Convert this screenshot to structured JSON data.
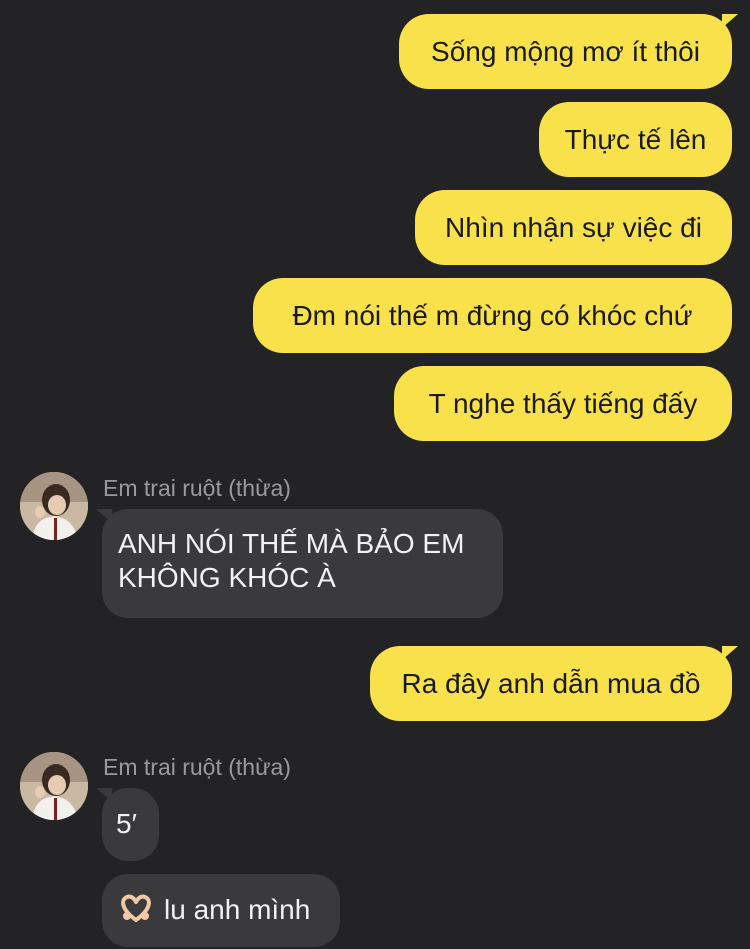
{
  "conversation": {
    "outgoing_top": [
      "Sống mộng mơ ít thôi",
      "Thực tế lên",
      "Nhìn nhận sự việc đi",
      "Đm nói thế m đừng có khóc chứ",
      "T nghe thấy tiếng đấy"
    ],
    "incoming_1": {
      "sender": "Em trai ruột (thừa)",
      "lines": [
        "ANH NÓI THẾ MÀ BẢO EM",
        "KHÔNG KHÓC À"
      ]
    },
    "outgoing_mid": "Ra đây anh dẫn mua đồ",
    "incoming_2": {
      "sender": "Em trai ruột (thừa)",
      "message_1": "5′",
      "message_2": "lu anh mình",
      "message_2_icon": "heart-hands-icon"
    }
  },
  "colors": {
    "background": "#232325",
    "outgoing_bubble": "#f8e14b",
    "incoming_bubble": "#3a3a3c",
    "sender_name": "#9a9a9e"
  }
}
